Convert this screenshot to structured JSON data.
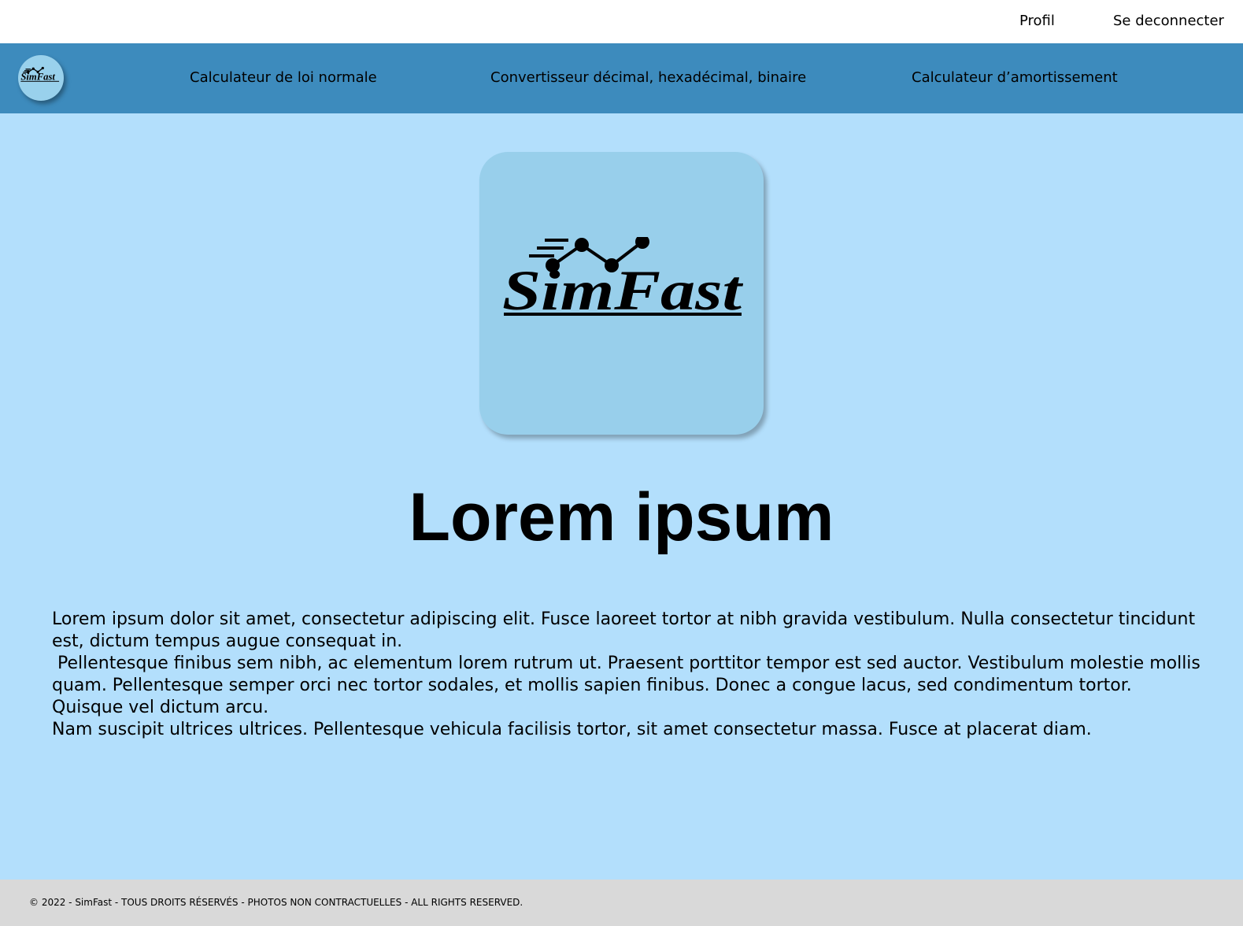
{
  "topbar": {
    "profile_label": "Profil",
    "logout_label": "Se deconnecter"
  },
  "nav": {
    "logo_text": "SimFast",
    "items": [
      {
        "label": "Calculateur de loi normale"
      },
      {
        "label": "Convertisseur décimal, hexadécimal, binaire"
      },
      {
        "label": "Calculateur d’amortissement"
      }
    ]
  },
  "hero": {
    "logo_text": "SimFast",
    "title": "Lorem ipsum"
  },
  "content": {
    "paragraphs": [
      "Lorem ipsum dolor sit amet, consectetur adipiscing elit. Fusce laoreet tortor at nibh gravida vestibulum. Nulla consectetur tincidunt est, dictum tempus augue consequat in.",
      " Pellentesque finibus sem nibh, ac elementum lorem rutrum ut. Praesent porttitor tempor est sed auctor. Vestibulum molestie mollis quam. Pellentesque semper orci nec tortor sodales, et mollis sapien finibus. Donec a congue lacus, sed condimentum tortor. Quisque vel dictum arcu.",
      "Nam suscipit ultrices ultrices. Pellentesque vehicula facilisis tortor, sit amet consectetur massa. Fusce at placerat diam."
    ]
  },
  "footer": {
    "copyright": "© 2022 - SimFast - TOUS DROITS RÉSERVÉS - PHOTOS NON CONTRACTUELLES - ALL RIGHTS RESERVED."
  },
  "colors": {
    "page_bg": "#b3dffc",
    "navbar_bg": "#3d8bbd",
    "logo_bg": "#98cfeb",
    "footer_bg": "#d9d9d9"
  }
}
